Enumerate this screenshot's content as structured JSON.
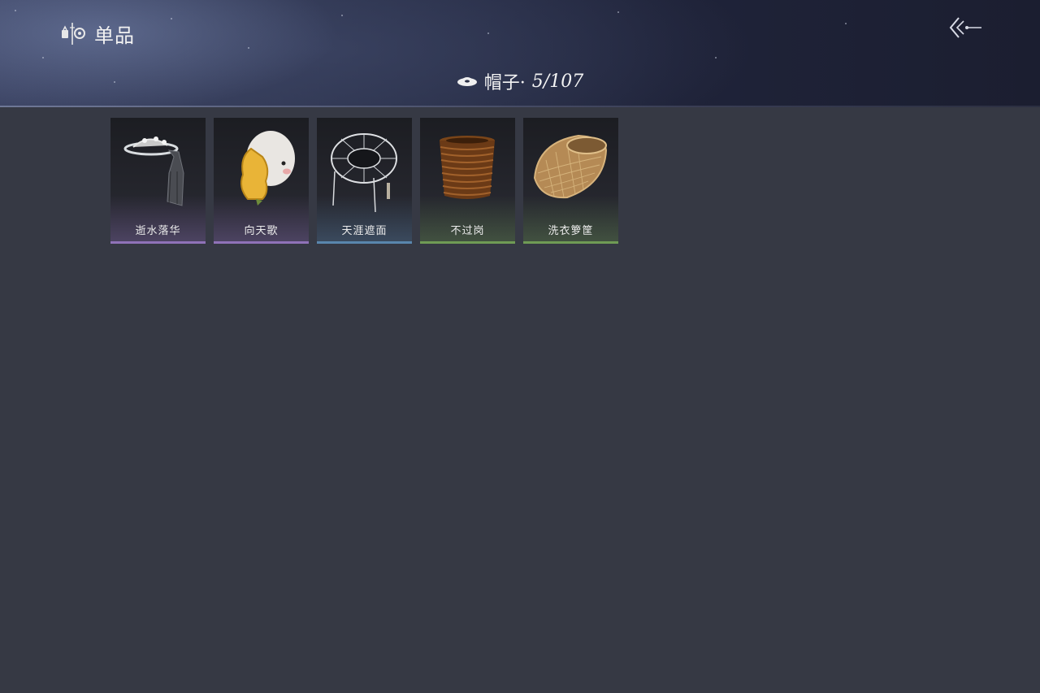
{
  "header": {
    "title": "单品",
    "category_icon": "hat-icon",
    "category_name": "帽子·",
    "category_count": "5/107",
    "back_icon": "back-arrow-icon"
  },
  "items": [
    {
      "label": "逝水落华",
      "rarity_color": "#8f72b8",
      "icon": "veiled-hat-icon"
    },
    {
      "label": "向天歌",
      "rarity_color": "#8f72b8",
      "icon": "goose-hat-icon"
    },
    {
      "label": "天涯遮面",
      "rarity_color": "#5a86ad",
      "icon": "wire-bamboo-hat-icon"
    },
    {
      "label": "不过岗",
      "rarity_color": "#6f9b55",
      "icon": "stacked-bowls-hat-icon"
    },
    {
      "label": "洗衣箩筐",
      "rarity_color": "#6f9b55",
      "icon": "wicker-basket-hat-icon"
    }
  ]
}
